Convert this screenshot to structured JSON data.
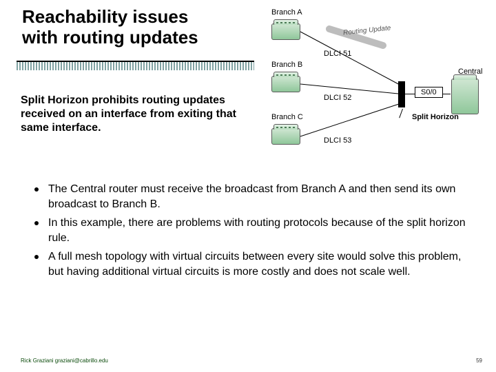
{
  "title_line1": "Reachability issues",
  "title_line2": "with routing updates",
  "subhead": "Split Horizon prohibits routing updates received on an interface from exiting that same interface.",
  "bullets": [
    "The Central router must receive the broadcast from Branch A and then send its own broadcast to Branch B.",
    "In this example, there are problems with routing protocols because of the split horizon rule.",
    "A full mesh topology with virtual circuits between every site would solve this problem, but having additional virtual circuits is more costly and does not scale well."
  ],
  "diagram": {
    "branchA": "Branch A",
    "branchB": "Branch B",
    "branchC": "Branch C",
    "central": "Central",
    "dlci51": "DLCI 51",
    "dlci52": "DLCI 52",
    "dlci53": "DLCI 53",
    "s0": "S0/0",
    "routing": "Routing Update",
    "splitHorizon": "Split Horizon"
  },
  "footer": {
    "author": "Rick Graziani  graziani@cabrillo.edu",
    "page": "59"
  }
}
